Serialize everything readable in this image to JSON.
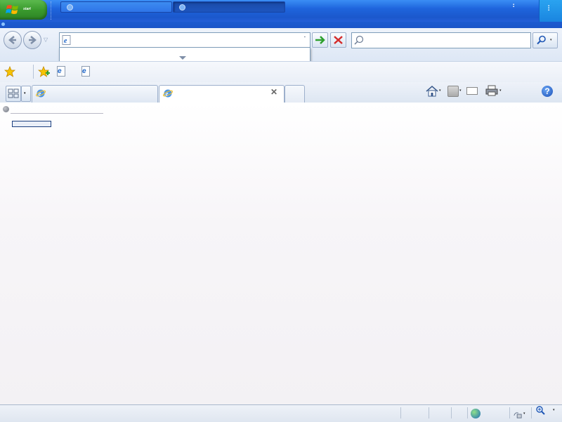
{
  "taskbar": {
    "start_label": "start",
    "buttons": [
      {
        "label": "",
        "icon": "folder-icon"
      },
      {
        "label": "",
        "icon": "ie-icon"
      }
    ],
    "clock": ""
  },
  "window": {
    "title": ""
  },
  "navigation": {
    "address_value": "",
    "suggestion_text": "",
    "history_label": "",
    "history_shortcut": "",
    "search_placeholder": ""
  },
  "menu": {
    "items": [
      "",
      "",
      "",
      "",
      ""
    ]
  },
  "favorites": {
    "label": "",
    "links": [
      "",
      ""
    ]
  },
  "tabs": [
    {
      "label": "",
      "active": false
    },
    {
      "label": "",
      "active": true
    }
  ],
  "commandbar": {
    "page_label": "",
    "safety_label": "",
    "tools_label": ""
  },
  "page": {
    "error_title": "",
    "try_label": "",
    "diagnose_button": "",
    "more_info": ""
  },
  "statusbar": {
    "status_text": "",
    "zone": "",
    "zoom": ""
  },
  "colors": {
    "taskbar_blue": "#245ed8",
    "start_green": "#3a9a2e",
    "title_blue": "#1d5bd0",
    "link_blue": "#2d61b7"
  }
}
